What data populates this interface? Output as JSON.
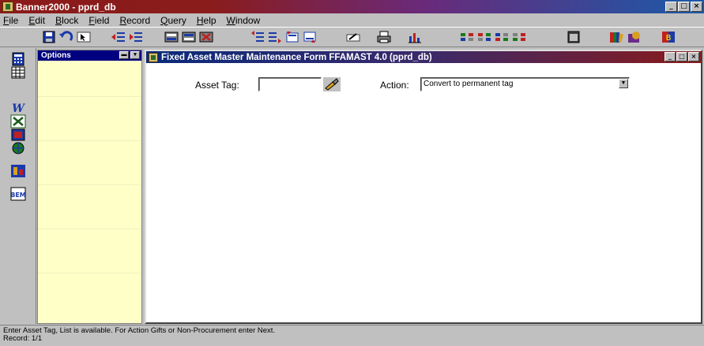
{
  "app": {
    "title": "Banner2000 - pprd_db",
    "window_buttons": [
      "_",
      "□",
      "×"
    ]
  },
  "menu": [
    "File",
    "Edit",
    "Block",
    "Field",
    "Record",
    "Query",
    "Help",
    "Window"
  ],
  "options_panel": {
    "title": "Options"
  },
  "form": {
    "title": "Fixed  Asset Master Maintenance Form  FFAMAST  4.0  (pprd_db)",
    "asset_tag_label": "Asset Tag:",
    "asset_tag_value": "",
    "action_label": "Action:",
    "action_value": "Convert to permanent tag"
  },
  "status": {
    "line1": "Enter Asset Tag, List is available.  For Action Gifts or Non-Procurement enter Next.",
    "line2": "Record: 1/1"
  },
  "icons": {
    "toolbar": [
      "save-icon",
      "rollback-icon",
      "select-icon",
      "insert-record-icon",
      "remove-record-icon",
      "enter-query-icon",
      "execute-query-icon",
      "cancel-query-icon",
      "previous-block-icon",
      "next-block-icon",
      "previous-record-icon",
      "next-record-icon",
      "edit-icon",
      "print-icon",
      "chart-icon",
      "list-of-values-icon",
      "count-hits-icon",
      "duplicate-icon",
      "clear-icon",
      "window-icon",
      "books-icon",
      "help-icon"
    ],
    "sidebar": [
      "calculator-icon",
      "grid-icon",
      "word-icon",
      "excel-icon",
      "picture-icon",
      "globe-icon",
      "sql-icon",
      "bem-icon"
    ]
  },
  "colors": {
    "title_gradient_start": "#8b1a1a",
    "title_gradient_end": "#1a5aa8",
    "options_bg": "#ffffc8",
    "options_title": "#000080"
  }
}
